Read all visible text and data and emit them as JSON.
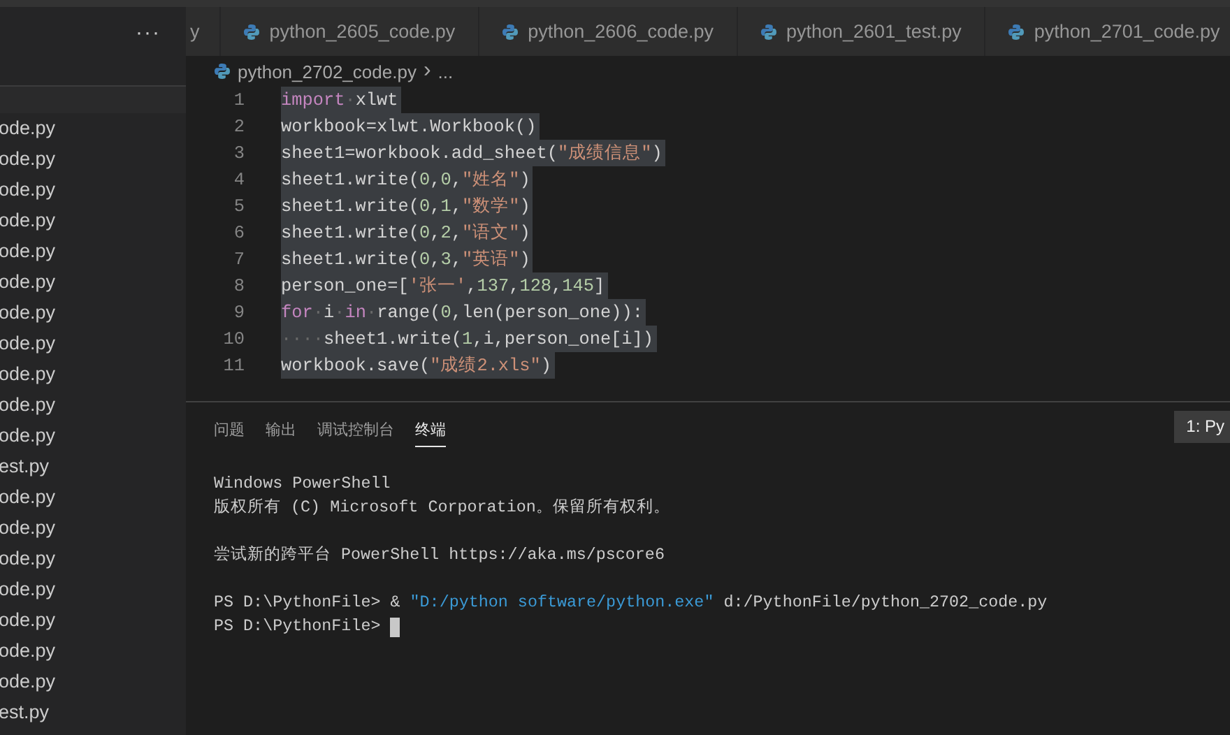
{
  "sidebar": {
    "more_label": "···",
    "files": [
      "ode.py",
      "ode.py",
      "ode.py",
      "ode.py",
      "ode.py",
      "ode.py",
      "ode.py",
      "ode.py",
      "ode.py",
      "ode.py",
      "ode.py",
      "est.py",
      "ode.py",
      "ode.py",
      "ode.py",
      "ode.py",
      "ode.py",
      "ode.py",
      "ode.py",
      "est.py"
    ]
  },
  "tabs": [
    {
      "label": "y",
      "icon": false,
      "selected": false
    },
    {
      "label": "python_2605_code.py",
      "icon": true,
      "selected": false
    },
    {
      "label": "python_2606_code.py",
      "icon": true,
      "selected": false
    },
    {
      "label": "python_2601_test.py",
      "icon": true,
      "selected": false
    },
    {
      "label": "python_2701_code.py",
      "icon": true,
      "selected": false
    }
  ],
  "breadcrumb": {
    "file": "python_2702_code.py",
    "separator": "›",
    "more": "..."
  },
  "editor": {
    "lines": [
      {
        "number": "1",
        "selected": true,
        "tokens": [
          {
            "kind": "kw",
            "text": "import"
          },
          {
            "kind": "ws",
            "text": "·"
          },
          {
            "kind": "plain",
            "text": "xlwt"
          }
        ]
      },
      {
        "number": "2",
        "selected": true,
        "tokens": [
          {
            "kind": "plain",
            "text": "workbook=xlwt.Workbook()"
          }
        ]
      },
      {
        "number": "3",
        "selected": true,
        "tokens": [
          {
            "kind": "plain",
            "text": "sheet1=workbook.add_sheet("
          },
          {
            "kind": "str",
            "text": "\"成绩信息\""
          },
          {
            "kind": "plain",
            "text": ")"
          }
        ]
      },
      {
        "number": "4",
        "selected": true,
        "tokens": [
          {
            "kind": "plain",
            "text": "sheet1.write("
          },
          {
            "kind": "num",
            "text": "0"
          },
          {
            "kind": "plain",
            "text": ","
          },
          {
            "kind": "num",
            "text": "0"
          },
          {
            "kind": "plain",
            "text": ","
          },
          {
            "kind": "str",
            "text": "\"姓名\""
          },
          {
            "kind": "plain",
            "text": ")"
          }
        ]
      },
      {
        "number": "5",
        "selected": true,
        "tokens": [
          {
            "kind": "plain",
            "text": "sheet1.write("
          },
          {
            "kind": "num",
            "text": "0"
          },
          {
            "kind": "plain",
            "text": ","
          },
          {
            "kind": "num",
            "text": "1"
          },
          {
            "kind": "plain",
            "text": ","
          },
          {
            "kind": "str",
            "text": "\"数学\""
          },
          {
            "kind": "plain",
            "text": ")"
          }
        ]
      },
      {
        "number": "6",
        "selected": true,
        "tokens": [
          {
            "kind": "plain",
            "text": "sheet1.write("
          },
          {
            "kind": "num",
            "text": "0"
          },
          {
            "kind": "plain",
            "text": ","
          },
          {
            "kind": "num",
            "text": "2"
          },
          {
            "kind": "plain",
            "text": ","
          },
          {
            "kind": "str",
            "text": "\"语文\""
          },
          {
            "kind": "plain",
            "text": ")"
          }
        ]
      },
      {
        "number": "7",
        "selected": true,
        "tokens": [
          {
            "kind": "plain",
            "text": "sheet1.write("
          },
          {
            "kind": "num",
            "text": "0"
          },
          {
            "kind": "plain",
            "text": ","
          },
          {
            "kind": "num",
            "text": "3"
          },
          {
            "kind": "plain",
            "text": ","
          },
          {
            "kind": "str",
            "text": "\"英语\""
          },
          {
            "kind": "plain",
            "text": ")"
          }
        ]
      },
      {
        "number": "8",
        "selected": true,
        "tokens": [
          {
            "kind": "plain",
            "text": "person_one=["
          },
          {
            "kind": "str",
            "text": "'张一'"
          },
          {
            "kind": "plain",
            "text": ","
          },
          {
            "kind": "num",
            "text": "137"
          },
          {
            "kind": "plain",
            "text": ","
          },
          {
            "kind": "num",
            "text": "128"
          },
          {
            "kind": "plain",
            "text": ","
          },
          {
            "kind": "num",
            "text": "145"
          },
          {
            "kind": "plain",
            "text": "]"
          }
        ]
      },
      {
        "number": "9",
        "selected": true,
        "tokens": [
          {
            "kind": "kw",
            "text": "for"
          },
          {
            "kind": "ws",
            "text": "·"
          },
          {
            "kind": "plain",
            "text": "i"
          },
          {
            "kind": "ws",
            "text": "·"
          },
          {
            "kind": "kw",
            "text": "in"
          },
          {
            "kind": "ws",
            "text": "·"
          },
          {
            "kind": "plain",
            "text": "range("
          },
          {
            "kind": "num",
            "text": "0"
          },
          {
            "kind": "plain",
            "text": ",len(person_one)):"
          }
        ]
      },
      {
        "number": "10",
        "selected": true,
        "tokens": [
          {
            "kind": "ws",
            "text": "····"
          },
          {
            "kind": "plain",
            "text": "sheet1.write("
          },
          {
            "kind": "num",
            "text": "1"
          },
          {
            "kind": "plain",
            "text": ",i,person_one[i])"
          }
        ]
      },
      {
        "number": "11",
        "selected": true,
        "tokens": [
          {
            "kind": "plain",
            "text": "workbook.save("
          },
          {
            "kind": "str",
            "text": "\"成绩2.xls\""
          },
          {
            "kind": "plain",
            "text": ")"
          }
        ]
      }
    ]
  },
  "panel": {
    "tabs": [
      {
        "label": "问题",
        "selected": false
      },
      {
        "label": "输出",
        "selected": false
      },
      {
        "label": "调试控制台",
        "selected": false
      },
      {
        "label": "终端",
        "selected": true
      }
    ],
    "terminal_select": "1: Py",
    "terminal_blocks": [
      [
        [
          {
            "kind": "plain",
            "text": "Windows PowerShell"
          }
        ],
        [
          {
            "kind": "plain",
            "text": "版权所有 (C) Microsoft Corporation。保留所有权利。"
          }
        ]
      ],
      [
        [
          {
            "kind": "plain",
            "text": "尝试新的跨平台 PowerShell https://aka.ms/pscore6"
          }
        ]
      ],
      [
        [
          {
            "kind": "plain",
            "text": "PS D:\\PythonFile> & "
          },
          {
            "kind": "str",
            "text": "\"D:/python software/python.exe\""
          },
          {
            "kind": "plain",
            "text": " d:/PythonFile/python_2702_code.py"
          }
        ],
        [
          {
            "kind": "plain",
            "text": "PS D:\\PythonFile> "
          }
        ]
      ]
    ],
    "cursor": true
  }
}
